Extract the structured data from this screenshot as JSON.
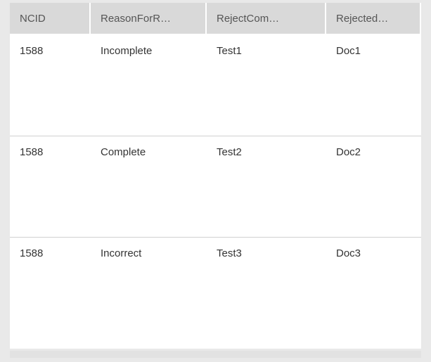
{
  "table": {
    "columns": [
      {
        "key": "ncid",
        "label": "NCID"
      },
      {
        "key": "reason",
        "label": "ReasonForR…"
      },
      {
        "key": "reject",
        "label": "RejectCom…"
      },
      {
        "key": "doc",
        "label": "Rejected…"
      }
    ],
    "rows": [
      {
        "ncid": "1588",
        "reason": "Incomplete",
        "reject": "Test1",
        "doc": "Doc1"
      },
      {
        "ncid": "1588",
        "reason": "Complete",
        "reject": "Test2",
        "doc": "Doc2"
      },
      {
        "ncid": "1588",
        "reason": "Incorrect",
        "reject": "Test3",
        "doc": "Doc3"
      }
    ]
  }
}
